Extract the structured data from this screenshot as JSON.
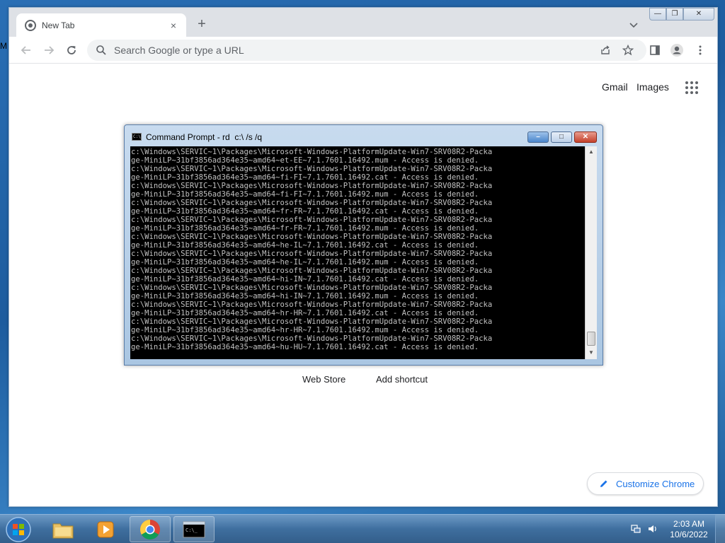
{
  "desktop": {
    "peek_letter": "M"
  },
  "chrome": {
    "tab": {
      "title": "New Tab",
      "close_glyph": "×"
    },
    "new_tab_glyph": "+",
    "omnibox": {
      "placeholder": "Search Google or type a URL",
      "value": ""
    },
    "ntp": {
      "gmail": "Gmail",
      "images": "Images",
      "shortcuts": [
        "Web Store",
        "Add shortcut"
      ],
      "customize_label": "Customize Chrome"
    }
  },
  "cmd": {
    "title": "Command Prompt - rd  c:\\ /s /q",
    "lines": [
      "c:\\Windows\\SERVIC~1\\Packages\\Microsoft-Windows-PlatformUpdate-Win7-SRV08R2-Packa",
      "ge-MiniLP~31bf3856ad364e35~amd64~et-EE~7.1.7601.16492.mum - Access is denied.",
      "c:\\Windows\\SERVIC~1\\Packages\\Microsoft-Windows-PlatformUpdate-Win7-SRV08R2-Packa",
      "ge-MiniLP~31bf3856ad364e35~amd64~fi-FI~7.1.7601.16492.cat - Access is denied.",
      "c:\\Windows\\SERVIC~1\\Packages\\Microsoft-Windows-PlatformUpdate-Win7-SRV08R2-Packa",
      "ge-MiniLP~31bf3856ad364e35~amd64~fi-FI~7.1.7601.16492.mum - Access is denied.",
      "c:\\Windows\\SERVIC~1\\Packages\\Microsoft-Windows-PlatformUpdate-Win7-SRV08R2-Packa",
      "ge-MiniLP~31bf3856ad364e35~amd64~fr-FR~7.1.7601.16492.cat - Access is denied.",
      "c:\\Windows\\SERVIC~1\\Packages\\Microsoft-Windows-PlatformUpdate-Win7-SRV08R2-Packa",
      "ge-MiniLP~31bf3856ad364e35~amd64~fr-FR~7.1.7601.16492.mum - Access is denied.",
      "c:\\Windows\\SERVIC~1\\Packages\\Microsoft-Windows-PlatformUpdate-Win7-SRV08R2-Packa",
      "ge-MiniLP~31bf3856ad364e35~amd64~he-IL~7.1.7601.16492.cat - Access is denied.",
      "c:\\Windows\\SERVIC~1\\Packages\\Microsoft-Windows-PlatformUpdate-Win7-SRV08R2-Packa",
      "ge-MiniLP~31bf3856ad364e35~amd64~he-IL~7.1.7601.16492.mum - Access is denied.",
      "c:\\Windows\\SERVIC~1\\Packages\\Microsoft-Windows-PlatformUpdate-Win7-SRV08R2-Packa",
      "ge-MiniLP~31bf3856ad364e35~amd64~hi-IN~7.1.7601.16492.cat - Access is denied.",
      "c:\\Windows\\SERVIC~1\\Packages\\Microsoft-Windows-PlatformUpdate-Win7-SRV08R2-Packa",
      "ge-MiniLP~31bf3856ad364e35~amd64~hi-IN~7.1.7601.16492.mum - Access is denied.",
      "c:\\Windows\\SERVIC~1\\Packages\\Microsoft-Windows-PlatformUpdate-Win7-SRV08R2-Packa",
      "ge-MiniLP~31bf3856ad364e35~amd64~hr-HR~7.1.7601.16492.cat - Access is denied.",
      "c:\\Windows\\SERVIC~1\\Packages\\Microsoft-Windows-PlatformUpdate-Win7-SRV08R2-Packa",
      "ge-MiniLP~31bf3856ad364e35~amd64~hr-HR~7.1.7601.16492.mum - Access is denied.",
      "c:\\Windows\\SERVIC~1\\Packages\\Microsoft-Windows-PlatformUpdate-Win7-SRV08R2-Packa",
      "ge-MiniLP~31bf3856ad364e35~amd64~hu-HU~7.1.7601.16492.cat - Access is denied."
    ]
  },
  "taskbar": {
    "clock_time": "2:03 AM",
    "clock_date": "10/6/2022",
    "cmd_icon_text": "C:\\_"
  },
  "colors": {
    "chrome_tabstrip": "#dee1e6",
    "link_blue": "#1a73e8",
    "console_bg": "#000000",
    "console_text": "#c0c0c0",
    "taskbar": "#3f6f9f"
  }
}
